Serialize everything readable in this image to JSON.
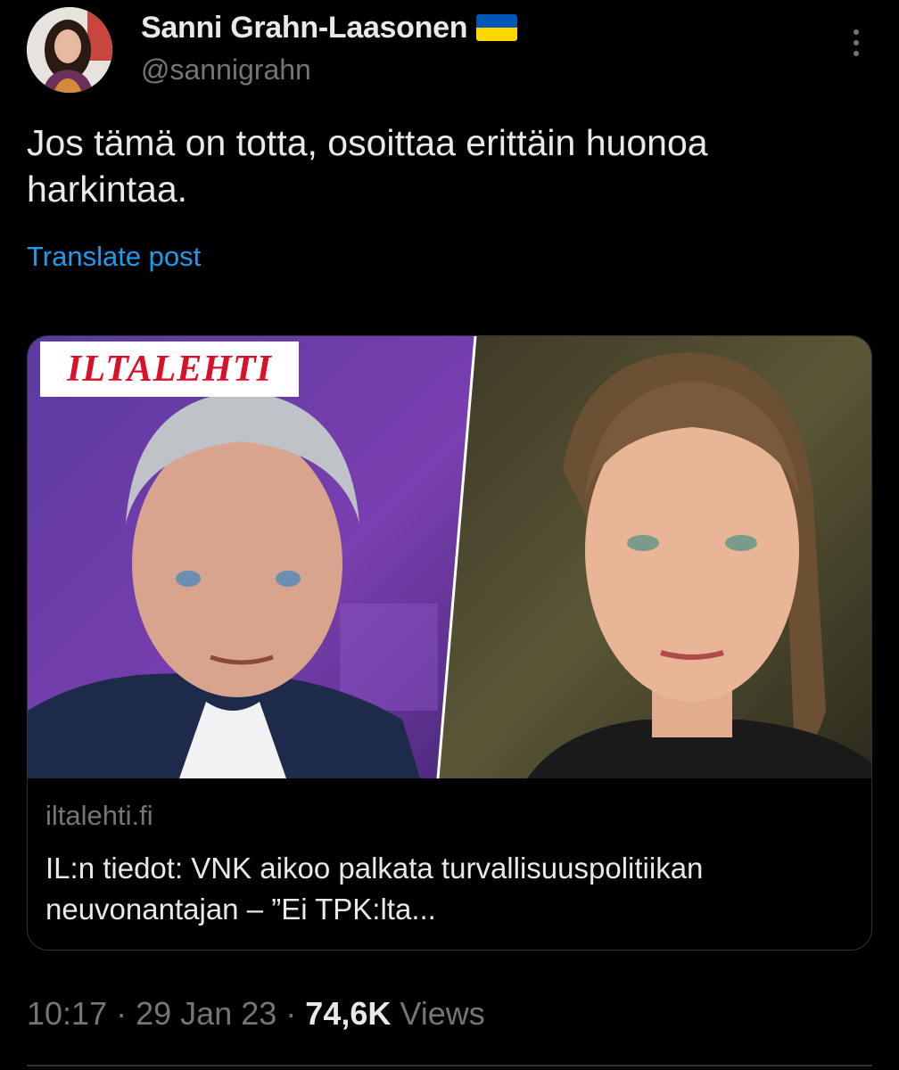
{
  "author": {
    "display_name": "Sanni Grahn-Laasonen",
    "handle": "@sannigrahn",
    "flag_icon": "ukraine-flag-icon",
    "flag_colors": [
      "#0057B7",
      "#FFD700"
    ]
  },
  "tweet": {
    "text": "Jos tämä on totta, osoittaa erittäin huonoa harkintaa.",
    "translate_label": "Translate post"
  },
  "card": {
    "logo_text": "ILTALEHTI",
    "domain": "iltalehti.fi",
    "title": "IL:n tiedot: VNK aikoo palkata turvallisuuspolitiikan neuvonantajan – ”Ei TPK:lta..."
  },
  "meta": {
    "time": "10:17",
    "separator": "·",
    "date": "29 Jan 23",
    "views_count": "74,6K",
    "views_label": "Views"
  },
  "colors": {
    "background": "#000000",
    "link": "#1d9bf0",
    "secondary_text": "#71767b",
    "logo_red": "#d8102a"
  }
}
